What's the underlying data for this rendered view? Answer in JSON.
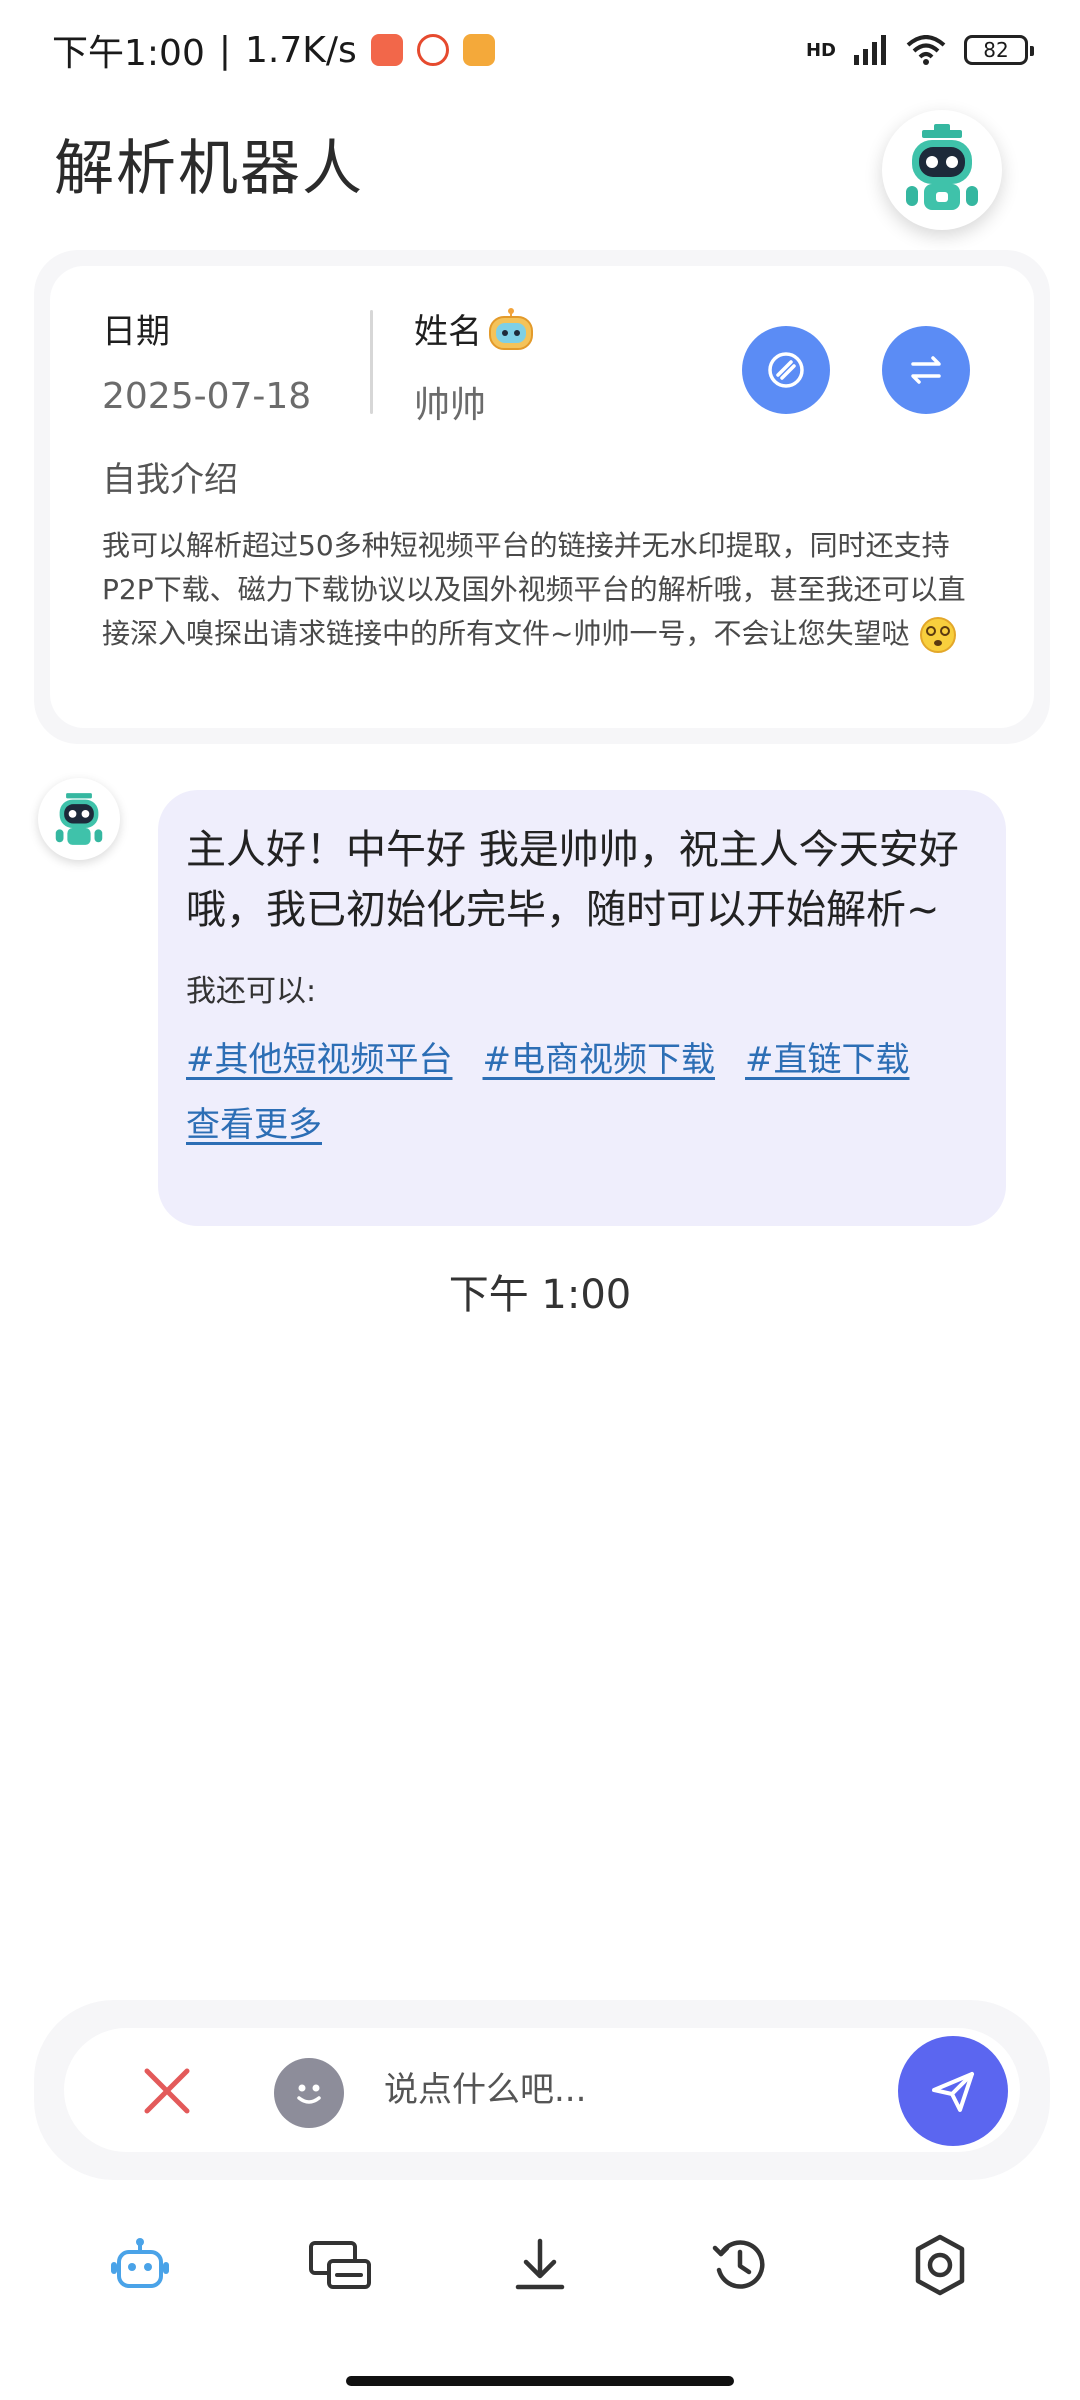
{
  "status_bar": {
    "time": "下午1:00",
    "separator": "|",
    "net_speed": "1.7K/s",
    "network_label": "HD",
    "battery": "82"
  },
  "header": {
    "title": "解析机器人"
  },
  "info_card": {
    "date_label": "日期",
    "date_value": "2025-07-18",
    "name_label": "姓名",
    "name_value": "帅帅",
    "intro_label": "自我介绍",
    "intro_text": "我可以解析超过50多种短视频平台的链接并无水印提取，同时还支持P2P下载、磁力下载协议以及国外视频平台的解析哦，甚至我还可以直接深入嗅探出请求链接中的所有文件~帅帅一号，不会让您失望哒"
  },
  "chat": {
    "message": "主人好！中午好 我是帅帅，祝主人今天安好哦，我已初始化完毕，随时可以开始解析~",
    "sub_label": "我还可以:",
    "tags": [
      "#其他短视频平台",
      "#电商视频下载",
      "#直链下载"
    ],
    "more_label": "查看更多",
    "timestamp": "下午 1:00"
  },
  "input": {
    "placeholder": "说点什么吧..."
  },
  "colors": {
    "accent": "#5b66f0",
    "action_blue": "#5b8cf5",
    "link": "#2c6eb5",
    "bubble_bg": "#efeefc",
    "nav_active": "#4aa3e8"
  },
  "bottom_nav": {
    "items": [
      "robot-icon",
      "devices-icon",
      "download-icon",
      "history-icon",
      "settings-icon"
    ]
  }
}
